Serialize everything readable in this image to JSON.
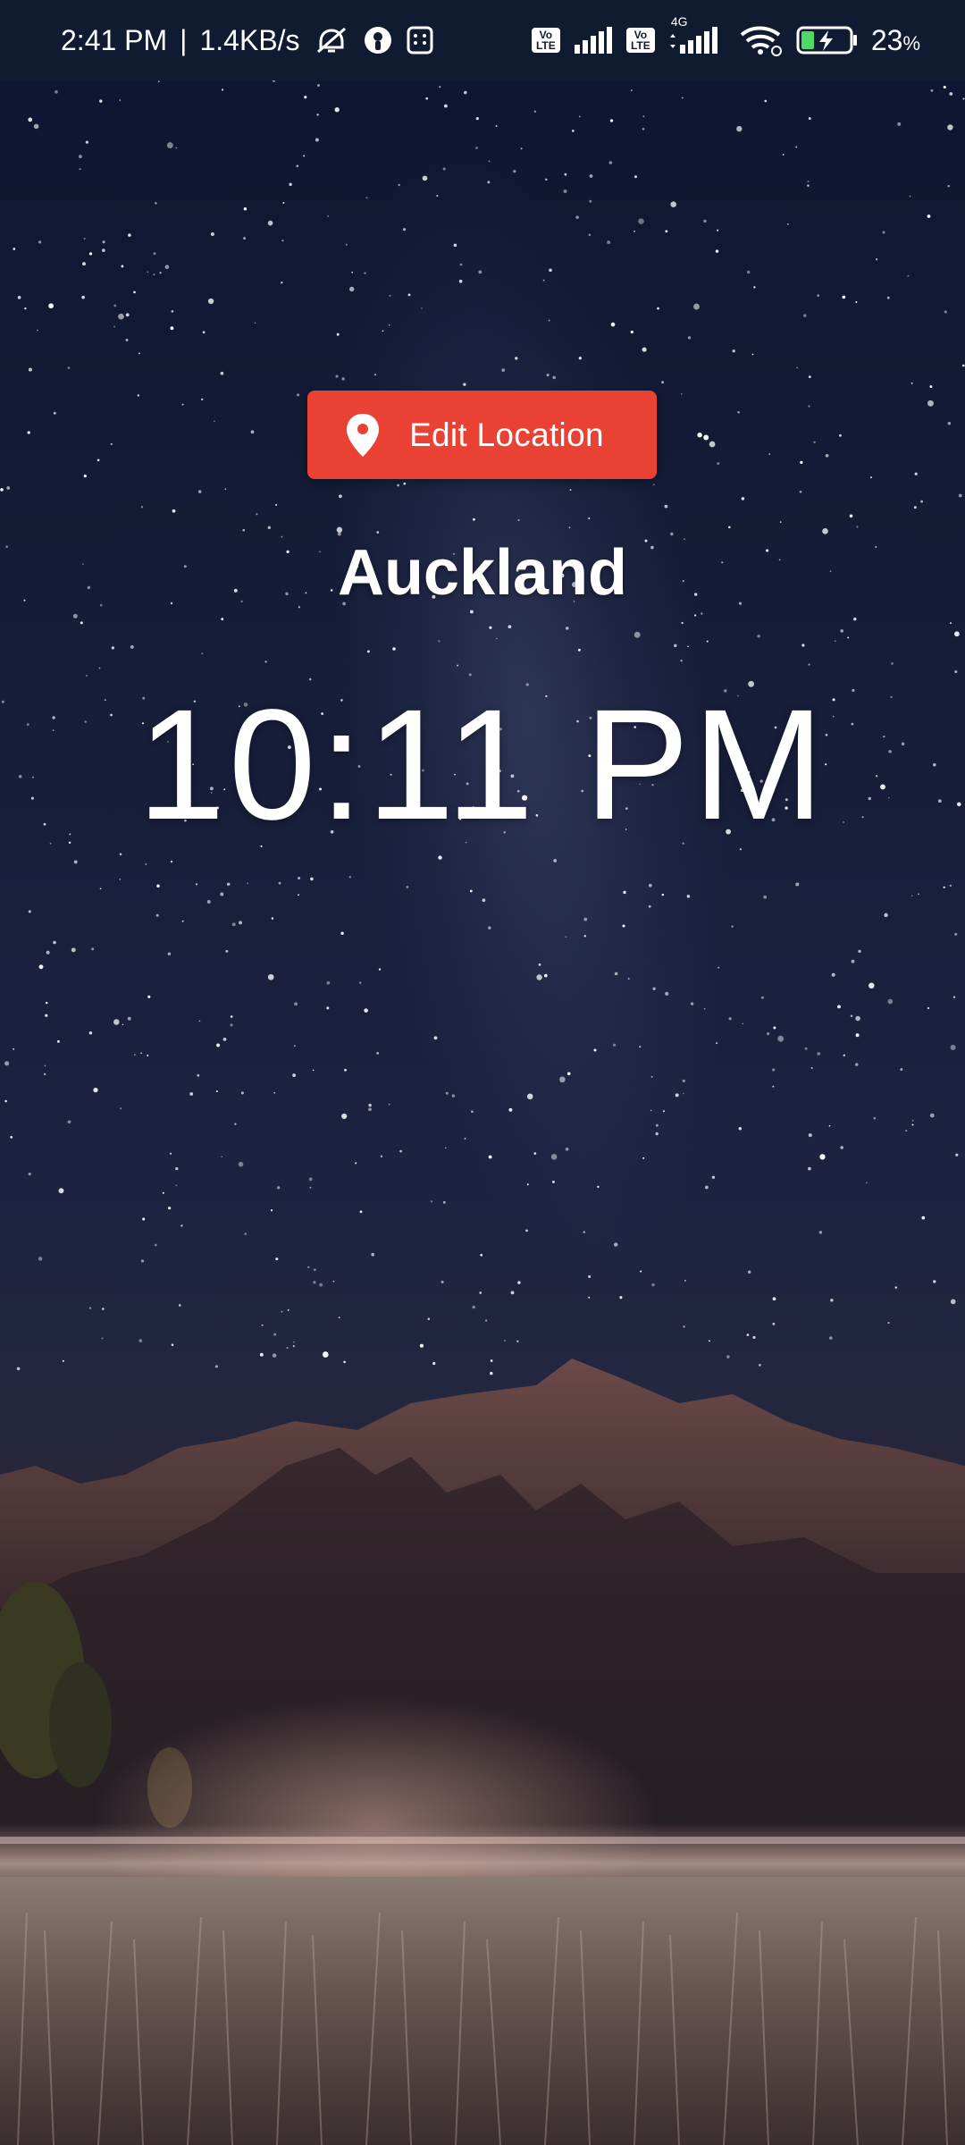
{
  "status_bar": {
    "time": "2:41 PM",
    "separator": "|",
    "network_speed": "1.4KB/s",
    "volte1": "Vo LTE",
    "volte2": "Vo LTE",
    "network_type": "4G",
    "battery_percent": "23",
    "battery_unit": "%",
    "icons": [
      "alarm-off-icon",
      "app-icon",
      "calculator-icon",
      "volte-icon",
      "signal-icon",
      "volte-icon",
      "signal-4g-icon",
      "wifi-icon",
      "battery-charging-icon"
    ]
  },
  "edit_location": {
    "label": "Edit Location",
    "icon": "location-pin-icon",
    "color": "#e94235"
  },
  "location": {
    "city": "Auckland",
    "time": "10:11 PM"
  }
}
